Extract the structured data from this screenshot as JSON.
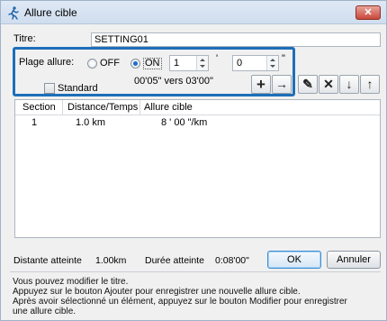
{
  "window": {
    "title": "Allure cible",
    "close_glyph": "✕",
    "icon": "runner-icon"
  },
  "titre": {
    "label": "Titre:",
    "value": "SETTING01"
  },
  "plage": {
    "label": "Plage allure:",
    "off_label": "OFF",
    "on_label": "ON",
    "selected": "ON",
    "minutes_value": "1",
    "minutes_unit": "'",
    "seconds_value": "0",
    "seconds_unit": "\"",
    "range_text": "00'05\" vers 03'00\"",
    "standard_label": "Standard",
    "standard_checked": false
  },
  "toolbar": {
    "add_glyph": "+",
    "add_icon": "add-icon",
    "insert_glyph": "→",
    "insert_icon": "arrow-right-icon",
    "edit_glyph": "✎",
    "edit_icon": "pencil-icon",
    "delete_glyph": "✕",
    "delete_icon": "delete-icon",
    "down_glyph": "↓",
    "down_icon": "arrow-down-icon",
    "up_glyph": "↑",
    "up_icon": "arrow-up-icon"
  },
  "table": {
    "headers": [
      "Section",
      "Distance/Temps",
      "Allure cible"
    ],
    "rows": [
      {
        "section": "1",
        "distance": "1.0 km",
        "allure": "8 ' 00 \"/km"
      }
    ]
  },
  "status": {
    "distance_label": "Distante atteinte",
    "distance_value": "1.00km",
    "duree_label": "Durée atteinte",
    "duree_value": "0:08'00\""
  },
  "buttons": {
    "ok": "OK",
    "cancel": "Annuler"
  },
  "help": {
    "lines": [
      "Vous pouvez modifier le titre.",
      "Appuyez sur le bouton Ajouter pour enregistrer une nouvelle allure cible.",
      "Après avoir sélectionné un élément, appuyez sur le bouton Modifier pour enregistrer",
      "une allure cible."
    ]
  },
  "colors": {
    "highlight": "#1e6fb8",
    "close_button": "#c9473a",
    "radio_selected": "#1d6bd1"
  }
}
